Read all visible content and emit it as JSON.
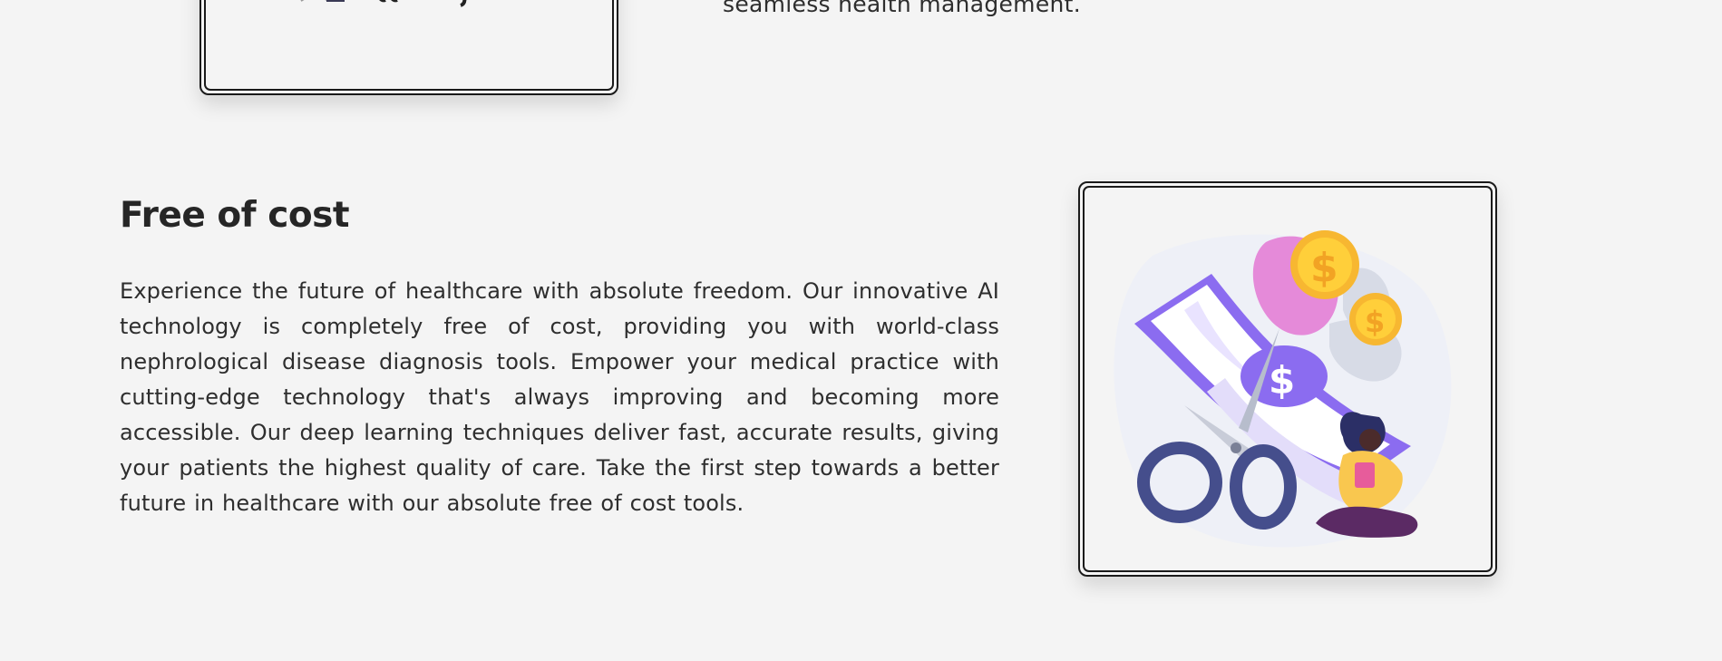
{
  "top_section": {
    "text_tail": "seamless health management."
  },
  "free_section": {
    "title": "Free of cost",
    "body": "Experience the future of healthcare with absolute freedom. Our innovative AI technology is completely free of cost, providing you with world-class nephrological disease diagnosis tools. Empower your medical practice with cutting-edge technology that's always improving and becoming more accessible. Our deep learning techniques deliver fast, accurate results, giving your patients the highest quality of care. Take the first step towards a better future in healthcare with our absolute free of cost tools.",
    "illustration_icon": "money-cut-scissors-illustration"
  },
  "colors": {
    "background": "#f4f4f4",
    "text": "#2e2e2e",
    "frame": "#1a1a1a",
    "purple": "#8b6cf0",
    "gold": "#f7b731"
  }
}
